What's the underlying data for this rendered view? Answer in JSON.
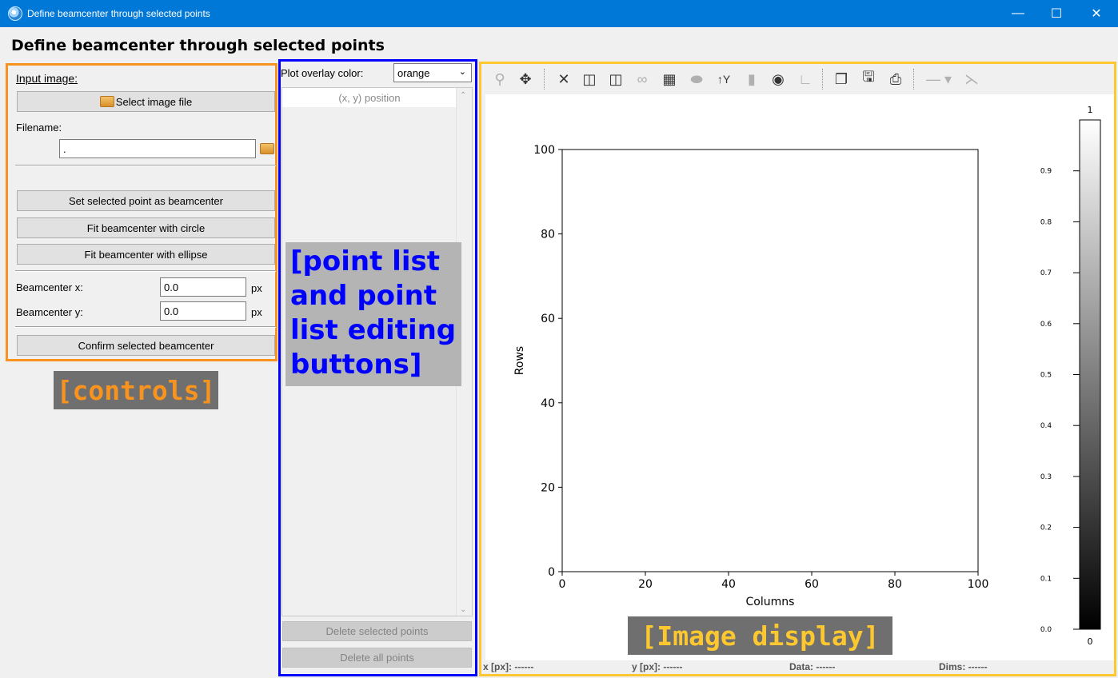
{
  "window": {
    "title": "Define beamcenter through selected points",
    "minimize": "—",
    "maximize": "☐",
    "close": "✕"
  },
  "heading": "Define beamcenter through selected points",
  "controls": {
    "input_image_label": "Input image:",
    "select_image_button": "Select image file",
    "filename_label": "Filename:",
    "filename_value": ".",
    "set_point_button": "Set selected point as beamcenter",
    "fit_circle_button": "Fit beamcenter with circle",
    "fit_ellipse_button": "Fit beamcenter with ellipse",
    "beamcenter_x_label": "Beamcenter x:",
    "beamcenter_x_value": "0.0",
    "beamcenter_y_label": "Beamcenter y:",
    "beamcenter_y_value": "0.0",
    "unit": "px",
    "confirm_button": "Confirm selected beamcenter"
  },
  "pointlist": {
    "overlay_color_label": "Plot overlay color:",
    "overlay_color_value": "orange",
    "list_header": "(x, y) position",
    "delete_selected_button": "Delete selected points",
    "delete_all_button": "Delete all points"
  },
  "status": {
    "x": "x [px]: ------",
    "y": "y [px]: ------",
    "data": "Data: ------",
    "dims": "Dims: ------"
  },
  "annotations": {
    "controls": "[controls]",
    "pointlist": "[point list and point list editing buttons]",
    "display": "[Image display]"
  },
  "colors": {
    "titlebar": "#0078d7",
    "controls_border": "#f7931e",
    "pointlist_border": "#0000ff",
    "display_border": "#fdc82f"
  },
  "toolbar_icons": [
    "zoom-icon",
    "pan-icon",
    "reset-zoom-icon",
    "colormap-icon",
    "keep-aspect-icon",
    "y-axis-icon",
    "profile-icon",
    "mask-icon",
    "copy-icon",
    "save-icon",
    "print-icon",
    "line-style-icon"
  ],
  "chart_data": {
    "type": "heatmap",
    "xlabel": "Columns",
    "ylabel": "Rows",
    "xlim": [
      0,
      100
    ],
    "ylim": [
      0,
      100
    ],
    "x_ticks": [
      0,
      20,
      40,
      60,
      80,
      100
    ],
    "y_ticks": [
      0,
      20,
      40,
      60,
      80,
      100
    ],
    "colorbar": {
      "min_label": "0",
      "max_label": "1",
      "range": [
        0.0,
        1.0
      ],
      "ticks": [
        "0.0",
        "0.1",
        "0.2",
        "0.3",
        "0.4",
        "0.5",
        "0.6",
        "0.7",
        "0.8",
        "0.9"
      ],
      "colormap": "gray"
    }
  }
}
